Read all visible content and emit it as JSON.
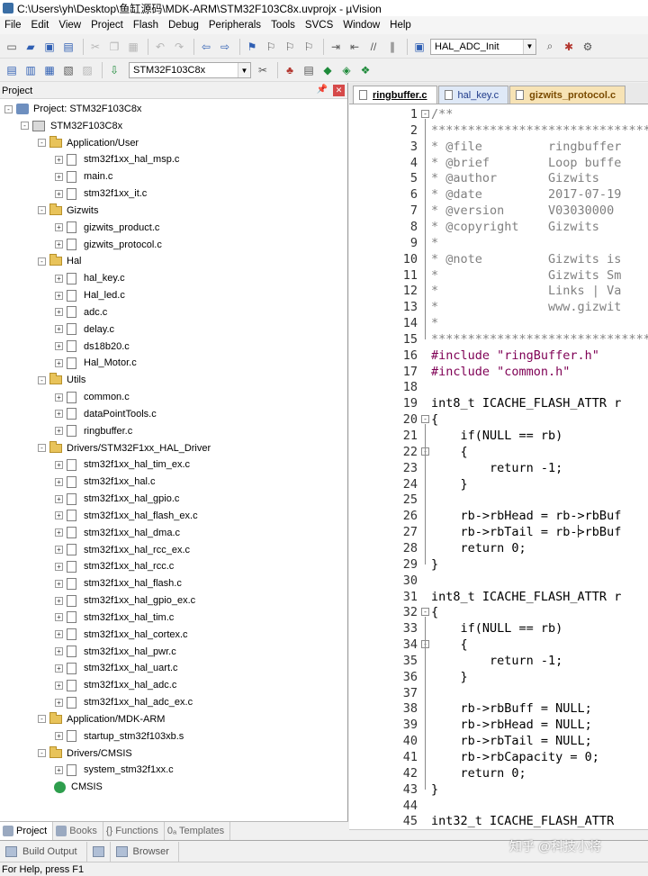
{
  "window": {
    "title": "C:\\Users\\yh\\Desktop\\鱼缸源码\\MDK-ARM\\STM32F103C8x.uvprojx - µVision"
  },
  "menu": [
    "File",
    "Edit",
    "View",
    "Project",
    "Flash",
    "Debug",
    "Peripherals",
    "Tools",
    "SVCS",
    "Window",
    "Help"
  ],
  "toolbar": {
    "find_combo_value": "HAL_ADC_Init",
    "target_combo_value": "STM32F103C8x"
  },
  "project_panel": {
    "title": "Project",
    "root": "Project: STM32F103C8x",
    "target": "STM32F103C8x",
    "groups": [
      {
        "name": "Application/User",
        "files": [
          "stm32f1xx_hal_msp.c",
          "main.c",
          "stm32f1xx_it.c"
        ]
      },
      {
        "name": "Gizwits",
        "files": [
          "gizwits_product.c",
          "gizwits_protocol.c"
        ]
      },
      {
        "name": "Hal",
        "files": [
          "hal_key.c",
          "Hal_led.c",
          "adc.c",
          "delay.c",
          "ds18b20.c",
          "Hal_Motor.c"
        ]
      },
      {
        "name": "Utils",
        "files": [
          "common.c",
          "dataPointTools.c",
          "ringbuffer.c"
        ]
      },
      {
        "name": "Drivers/STM32F1xx_HAL_Driver",
        "files": [
          "stm32f1xx_hal_tim_ex.c",
          "stm32f1xx_hal.c",
          "stm32f1xx_hal_gpio.c",
          "stm32f1xx_hal_flash_ex.c",
          "stm32f1xx_hal_dma.c",
          "stm32f1xx_hal_rcc_ex.c",
          "stm32f1xx_hal_rcc.c",
          "stm32f1xx_hal_flash.c",
          "stm32f1xx_hal_gpio_ex.c",
          "stm32f1xx_hal_tim.c",
          "stm32f1xx_hal_cortex.c",
          "stm32f1xx_hal_pwr.c",
          "stm32f1xx_hal_uart.c",
          "stm32f1xx_hal_adc.c",
          "stm32f1xx_hal_adc_ex.c"
        ]
      },
      {
        "name": "Application/MDK-ARM",
        "files": [
          "startup_stm32f103xb.s"
        ]
      },
      {
        "name": "Drivers/CMSIS",
        "files": [
          "system_stm32f1xx.c"
        ]
      }
    ],
    "cmsis": "CMSIS",
    "tabs": [
      "Project",
      "Books",
      "{} Functions",
      "0ₐ Templates"
    ]
  },
  "editor": {
    "tabs": [
      "ringbuffer.c",
      "hal_key.c",
      "gizwits_protocol.c"
    ],
    "lines": [
      {
        "n": "1",
        "t": "/**",
        "c": "c-comment",
        "f": "-"
      },
      {
        "n": "2",
        "t": "*******************************",
        "c": "c-comment"
      },
      {
        "n": "3",
        "t": "* @file         ringbuffer",
        "c": "c-comment"
      },
      {
        "n": "4",
        "t": "* @brief        Loop buffe",
        "c": "c-comment"
      },
      {
        "n": "5",
        "t": "* @author       Gizwits",
        "c": "c-comment"
      },
      {
        "n": "6",
        "t": "* @date         2017-07-19",
        "c": "c-comment"
      },
      {
        "n": "7",
        "t": "* @version      V03030000",
        "c": "c-comment"
      },
      {
        "n": "8",
        "t": "* @copyright    Gizwits",
        "c": "c-comment"
      },
      {
        "n": "9",
        "t": "*",
        "c": "c-comment"
      },
      {
        "n": "10",
        "t": "* @note         Gizwits is",
        "c": "c-comment"
      },
      {
        "n": "11",
        "t": "*               Gizwits Sm",
        "c": "c-comment"
      },
      {
        "n": "12",
        "t": "*               Links | Va",
        "c": "c-comment"
      },
      {
        "n": "13",
        "t": "*               www.gizwit",
        "c": "c-comment"
      },
      {
        "n": "14",
        "t": "*",
        "c": "c-comment"
      },
      {
        "n": "15",
        "t": "*******************************",
        "c": "c-comment"
      },
      {
        "n": "16",
        "t": "#include \"ringBuffer.h\"",
        "c": "c-pre"
      },
      {
        "n": "17",
        "t": "#include \"common.h\"",
        "c": "c-pre"
      },
      {
        "n": "18",
        "t": "",
        "c": ""
      },
      {
        "n": "19",
        "t": "int8_t ICACHE_FLASH_ATTR r",
        "c": ""
      },
      {
        "n": "20",
        "t": "{",
        "c": "",
        "f": "-"
      },
      {
        "n": "21",
        "t": "    if(NULL == rb)",
        "c": ""
      },
      {
        "n": "22",
        "t": "    {",
        "c": "",
        "f": "-"
      },
      {
        "n": "23",
        "t": "        return -1;",
        "c": ""
      },
      {
        "n": "24",
        "t": "    }",
        "c": ""
      },
      {
        "n": "25",
        "t": "",
        "c": ""
      },
      {
        "n": "26",
        "t": "    rb->rbHead = rb->rbBuf",
        "c": ""
      },
      {
        "n": "27",
        "t": "    rb->rbTail = rb->rbBuf",
        "c": ""
      },
      {
        "n": "28",
        "t": "    return 0;",
        "c": ""
      },
      {
        "n": "29",
        "t": "}",
        "c": ""
      },
      {
        "n": "30",
        "t": "",
        "c": ""
      },
      {
        "n": "31",
        "t": "int8_t ICACHE_FLASH_ATTR r",
        "c": ""
      },
      {
        "n": "32",
        "t": "{",
        "c": "",
        "f": "-"
      },
      {
        "n": "33",
        "t": "    if(NULL == rb)",
        "c": ""
      },
      {
        "n": "34",
        "t": "    {",
        "c": "",
        "f": "-"
      },
      {
        "n": "35",
        "t": "        return -1;",
        "c": ""
      },
      {
        "n": "36",
        "t": "    }",
        "c": ""
      },
      {
        "n": "37",
        "t": "",
        "c": ""
      },
      {
        "n": "38",
        "t": "    rb->rbBuff = NULL;",
        "c": ""
      },
      {
        "n": "39",
        "t": "    rb->rbHead = NULL;",
        "c": ""
      },
      {
        "n": "40",
        "t": "    rb->rbTail = NULL;",
        "c": ""
      },
      {
        "n": "41",
        "t": "    rb->rbCapacity = 0;",
        "c": ""
      },
      {
        "n": "42",
        "t": "    return 0;",
        "c": ""
      },
      {
        "n": "43",
        "t": "}",
        "c": ""
      },
      {
        "n": "44",
        "t": "",
        "c": ""
      },
      {
        "n": "45",
        "t": "int32_t ICACHE_FLASH_ATTR ",
        "c": ""
      }
    ]
  },
  "bottom_tabs": [
    "Build Output",
    "Browser"
  ],
  "status": "For Help, press F1",
  "watermark": "知乎 @科技小将"
}
